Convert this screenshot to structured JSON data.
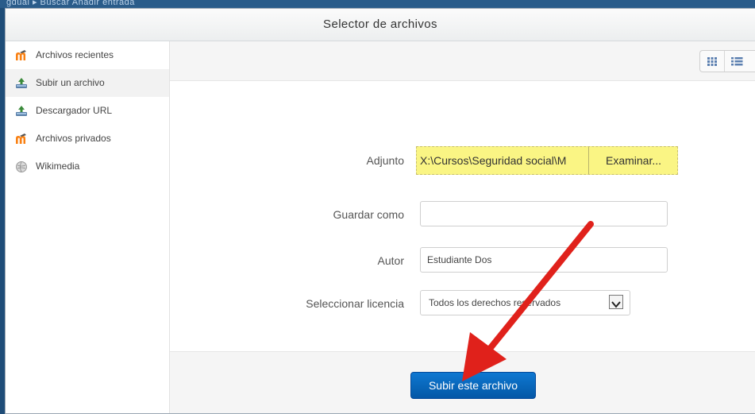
{
  "background_page": {
    "nav_text": "gdual ▸ Buscar   Añadir entrada"
  },
  "dialog": {
    "title": "Selector de archivos"
  },
  "sidebar": {
    "items": [
      {
        "label": "Archivos recientes",
        "icon": "moodle-logo-icon"
      },
      {
        "label": "Subir un archivo",
        "icon": "upload-icon"
      },
      {
        "label": "Descargador URL",
        "icon": "upload-icon"
      },
      {
        "label": "Archivos privados",
        "icon": "moodle-logo-icon"
      },
      {
        "label": "Wikimedia",
        "icon": "wikimedia-globe-icon"
      }
    ],
    "active_index": 1
  },
  "toolbar": {
    "view_icons": [
      "grid-view-icon",
      "list-view-icon"
    ]
  },
  "form": {
    "attachment_label": "Adjunto",
    "attachment_path": "X:\\Cursos\\Seguridad social\\M",
    "browse_label": "Examinar...",
    "save_as_label": "Guardar como",
    "save_as_value": "",
    "author_label": "Autor",
    "author_value": "Estudiante Dos",
    "license_label": "Seleccionar licencia",
    "license_value": "Todos los derechos reservados"
  },
  "footer": {
    "submit_label": "Subir este archivo"
  },
  "colors": {
    "accent": "#0a66bd",
    "highlight": "#faf584",
    "annotation_arrow": "#e0211b"
  }
}
